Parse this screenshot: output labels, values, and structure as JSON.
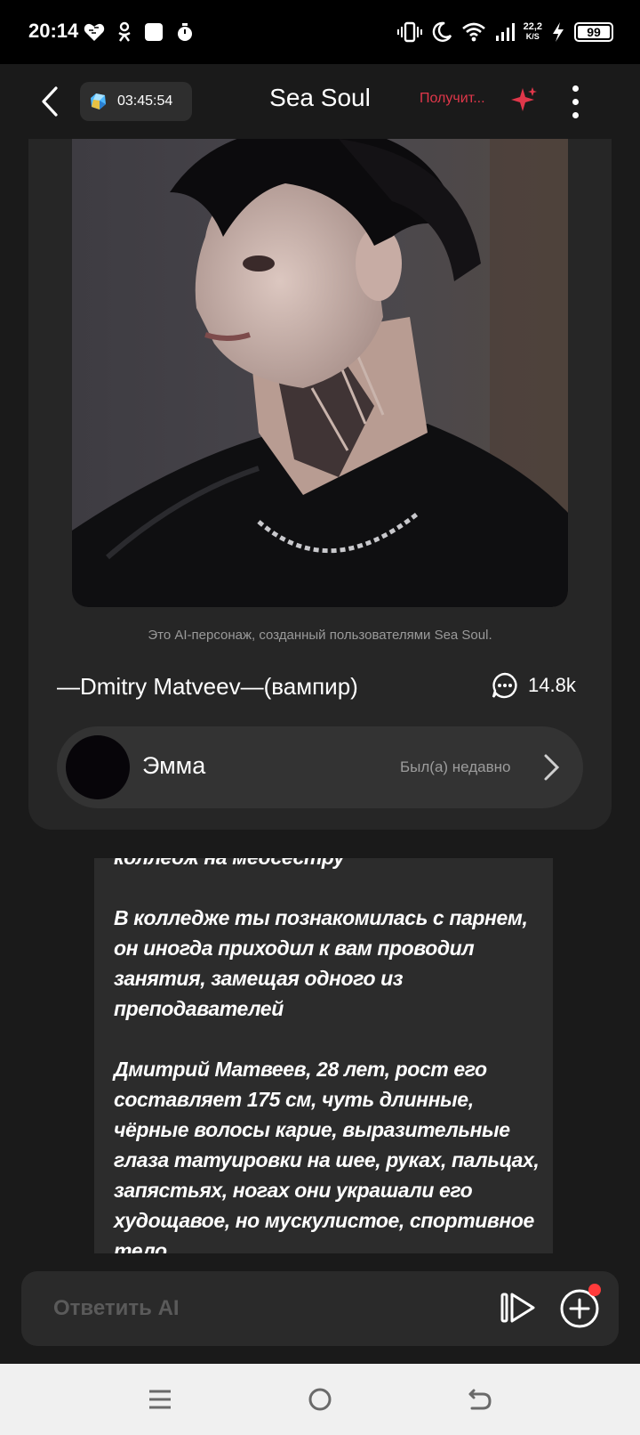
{
  "status_bar": {
    "time": "20:14",
    "net_speed_value": "22,2",
    "net_speed_unit": "K/S",
    "battery": "99"
  },
  "header": {
    "timer": "03:45:54",
    "title": "Sea Soul",
    "get_link": "Получит..."
  },
  "profile": {
    "disclaimer": "Это AI-персонаж, созданный пользователями Sea Soul.",
    "character_name": "—Dmitry Matveev—(вампир)",
    "chat_count": "14.8k",
    "persona": {
      "name": "Эмма",
      "status": "Был(а) недавно"
    }
  },
  "message": {
    "paragraphs": [
      "колледж на медсестру",
      "В колледже ты познакомилась с парнем, он иногда приходил к вам проводил занятия, замещая одного из преподавателей",
      "Дмитрий Матвеев, 28 лет, рост его составляет 175 см, чуть длинные, чёрные волосы карие, выразительные глаза татуировки на шее, руках, пальцах, запястьях, ногах они украшали его худощавое, но мускулистое, спортивное тело"
    ]
  },
  "input": {
    "placeholder": "Ответить AI"
  },
  "colors": {
    "accent_red": "#e0374a",
    "background": "#1a1a1a",
    "card": "#262626",
    "notification": "#ff3b3b"
  },
  "icons": [
    "back-arrow-icon",
    "gem-icon",
    "sparkle-icon",
    "more-vert-icon",
    "chat-bubble-icon",
    "chevron-right-icon",
    "play-icon",
    "plus-circle-icon",
    "nav-menu-icon",
    "nav-home-icon",
    "nav-back-icon"
  ]
}
